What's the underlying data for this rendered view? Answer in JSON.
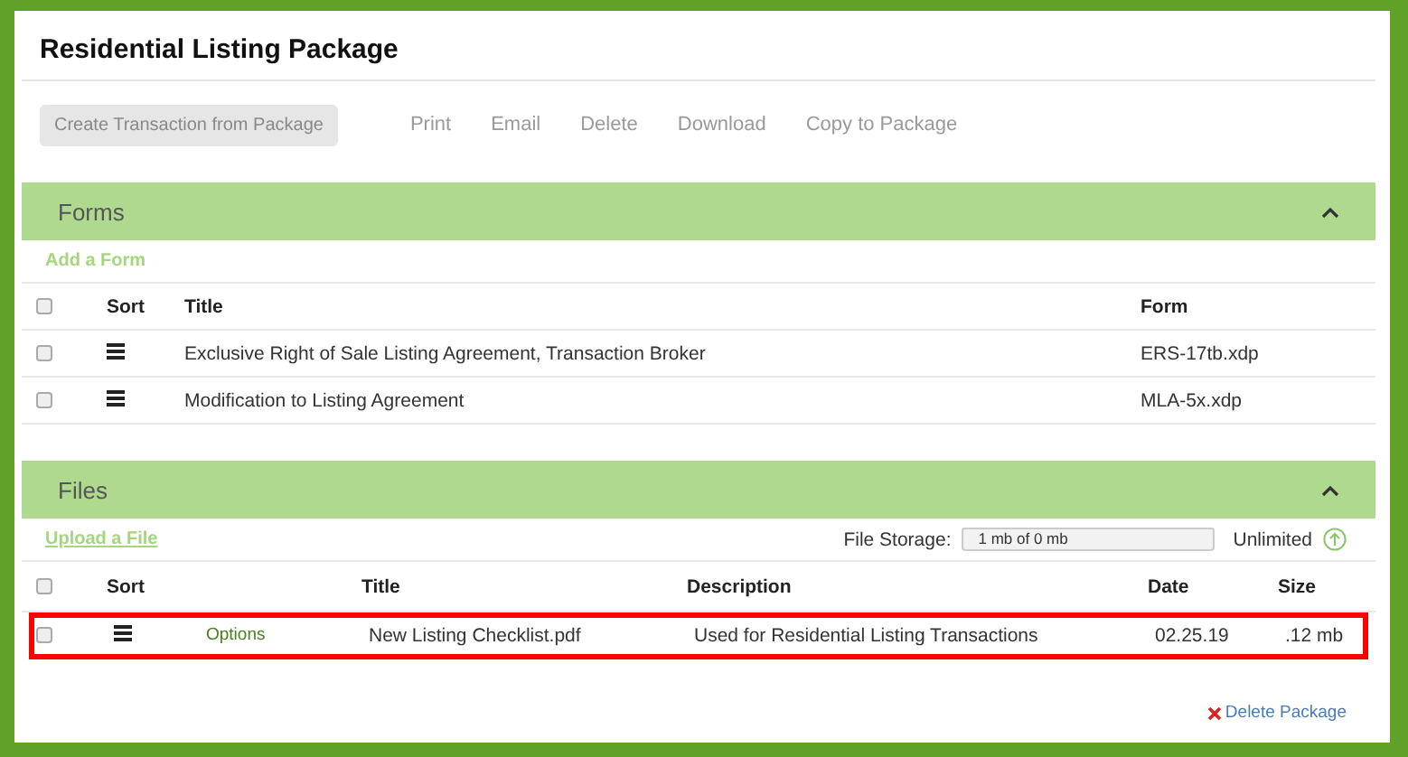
{
  "title": "Residential Listing Package",
  "toolbar": {
    "primary_button": "Create Transaction from Package",
    "actions": [
      "Print",
      "Email",
      "Delete",
      "Download",
      "Copy to Package"
    ]
  },
  "forms": {
    "heading": "Forms",
    "expanded": true,
    "add_link": "Add a Form",
    "columns": {
      "select_all_checked": false,
      "sort": "Sort",
      "title": "Title",
      "form": "Form"
    },
    "rows": [
      {
        "checked": false,
        "title": "Exclusive Right of Sale Listing Agreement, Transaction Broker",
        "form": "ERS-17tb.xdp"
      },
      {
        "checked": false,
        "title": "Modification to Listing Agreement",
        "form": "MLA-5x.xdp"
      }
    ]
  },
  "files": {
    "heading": "Files",
    "expanded": true,
    "upload_link": "Upload a File",
    "storage_label": "File Storage:",
    "storage_value": "1 mb of 0 mb",
    "storage_plan": "Unlimited",
    "columns": {
      "select_all_checked": false,
      "sort": "Sort",
      "title": "Title",
      "description": "Description",
      "date": "Date",
      "size": "Size"
    },
    "rows": [
      {
        "checked": false,
        "highlighted": true,
        "options": "Options",
        "title": "New Listing Checklist.pdf",
        "description": "Used for Residential Listing Transactions",
        "date": "02.25.19",
        "size": ".12 mb"
      }
    ]
  },
  "delete_package": "Delete Package"
}
